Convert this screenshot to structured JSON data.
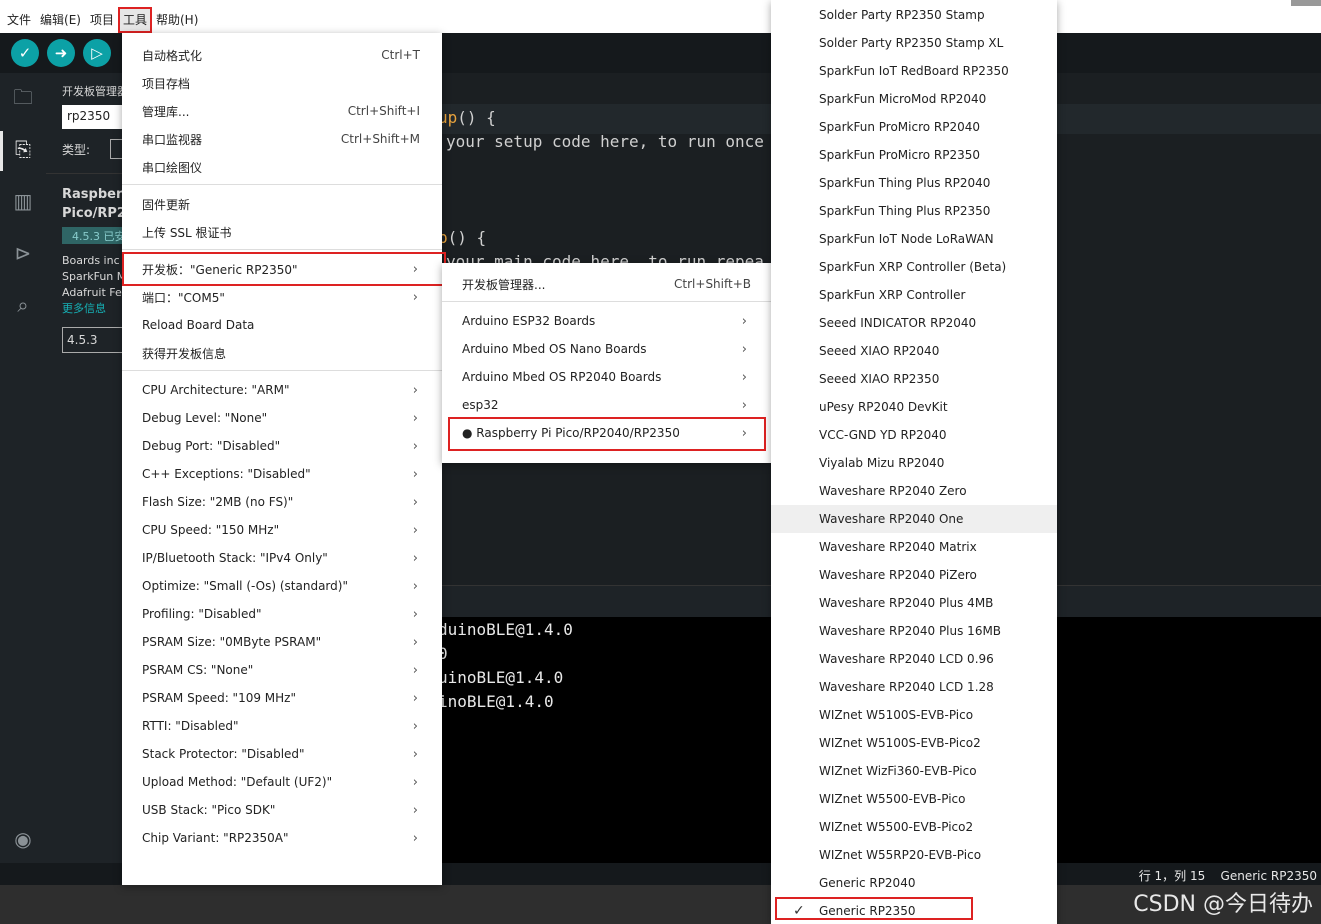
{
  "menubar": {
    "items": [
      "文件",
      "编辑(E)",
      "项目",
      "工具",
      "帮助(H)"
    ],
    "active_index": 3
  },
  "panel": {
    "title": "开发板管理器",
    "search_value": "rp2350",
    "type_label": "类型:",
    "board_name_line1": "Raspberry",
    "board_name_line2": "Pico/RP2",
    "installed_badge": "4.5.3 已安装",
    "desc_line1": "Boards inc",
    "desc_line2": "SparkFun M",
    "desc_line3": "Adafruit Fe",
    "more_link": "更多信息",
    "version_value": "4.5.3"
  },
  "editor": {
    "line1_fn": "up",
    "line1_rest": "() {",
    "line2": "your setup code here, to run once",
    "line3_fn": "p",
    "line3_rest": "() {",
    "line4": "your main code here, to run repea"
  },
  "output": {
    "lines": [
      "duinoBLE@1.4.0",
      "0",
      "uinoBLE@1.4.0",
      "inoBLE@1.4.0"
    ]
  },
  "status": {
    "position": "行 1，列 15",
    "board": "Generic RP2350"
  },
  "watermark": "CSDN @今日待办",
  "tools_menu": {
    "group1": [
      {
        "label": "自动格式化",
        "shortcut": "Ctrl+T"
      },
      {
        "label": "项目存档",
        "shortcut": ""
      },
      {
        "label": "管理库...",
        "shortcut": "Ctrl+Shift+I"
      },
      {
        "label": "串口监视器",
        "shortcut": "Ctrl+Shift+M"
      },
      {
        "label": "串口绘图仪",
        "shortcut": ""
      }
    ],
    "group2": [
      {
        "label": "固件更新"
      },
      {
        "label": "上传 SSL 根证书"
      }
    ],
    "group3": [
      {
        "label": "开发板：\"Generic RP2350\""
      },
      {
        "label": "端口：\"COM5\""
      },
      {
        "label": "Reload Board Data"
      },
      {
        "label": "获得开发板信息"
      }
    ],
    "group4": [
      {
        "label": "CPU Architecture: \"ARM\""
      },
      {
        "label": "Debug Level: \"None\""
      },
      {
        "label": "Debug Port: \"Disabled\""
      },
      {
        "label": "C++ Exceptions: \"Disabled\""
      },
      {
        "label": "Flash Size: \"2MB (no FS)\""
      },
      {
        "label": "CPU Speed: \"150 MHz\""
      },
      {
        "label": "IP/Bluetooth Stack: \"IPv4 Only\""
      },
      {
        "label": "Optimize: \"Small (-Os) (standard)\""
      },
      {
        "label": "Profiling: \"Disabled\""
      },
      {
        "label": "PSRAM Size: \"0MByte PSRAM\""
      },
      {
        "label": "PSRAM CS: \"None\""
      },
      {
        "label": "PSRAM Speed: \"109 MHz\""
      },
      {
        "label": "RTTI: \"Disabled\""
      },
      {
        "label": "Stack Protector: \"Disabled\""
      },
      {
        "label": "Upload Method: \"Default (UF2)\""
      },
      {
        "label": "USB Stack: \"Pico SDK\""
      },
      {
        "label": "Chip Variant: \"RP2350A\""
      }
    ]
  },
  "board_menu": {
    "manager": {
      "label": "开发板管理器...",
      "shortcut": "Ctrl+Shift+B"
    },
    "cores": [
      "Arduino ESP32 Boards",
      "Arduino Mbed OS Nano Boards",
      "Arduino Mbed OS RP2040 Boards",
      "esp32",
      "● Raspberry Pi Pico/RP2040/RP2350"
    ]
  },
  "boards_list": {
    "items": [
      "Solder Party RP2350 Stamp",
      "Solder Party RP2350 Stamp XL",
      "SparkFun IoT RedBoard RP2350",
      "SparkFun MicroMod RP2040",
      "SparkFun ProMicro RP2040",
      "SparkFun ProMicro RP2350",
      "SparkFun Thing Plus RP2040",
      "SparkFun Thing Plus RP2350",
      "SparkFun IoT Node LoRaWAN",
      "SparkFun XRP Controller (Beta)",
      "SparkFun XRP Controller",
      "Seeed INDICATOR RP2040",
      "Seeed XIAO RP2040",
      "Seeed XIAO RP2350",
      "uPesy RP2040 DevKit",
      "VCC-GND YD RP2040",
      "Viyalab Mizu RP2040",
      "Waveshare RP2040 Zero",
      "Waveshare RP2040 One",
      "Waveshare RP2040 Matrix",
      "Waveshare RP2040 PiZero",
      "Waveshare RP2040 Plus 4MB",
      "Waveshare RP2040 Plus 16MB",
      "Waveshare RP2040 LCD 0.96",
      "Waveshare RP2040 LCD 1.28",
      "WIZnet W5100S-EVB-Pico",
      "WIZnet W5100S-EVB-Pico2",
      "WIZnet WizFi360-EVB-Pico",
      "WIZnet W5500-EVB-Pico",
      "WIZnet W5500-EVB-Pico2",
      "WIZnet W55RP20-EVB-Pico",
      "Generic RP2040",
      "Generic RP2350"
    ],
    "hover_index": 18,
    "selected_index": 32,
    "check_mark": "✓"
  },
  "colors": {
    "accent": "#0ca1a6",
    "highlight_border": "#dd2222"
  }
}
